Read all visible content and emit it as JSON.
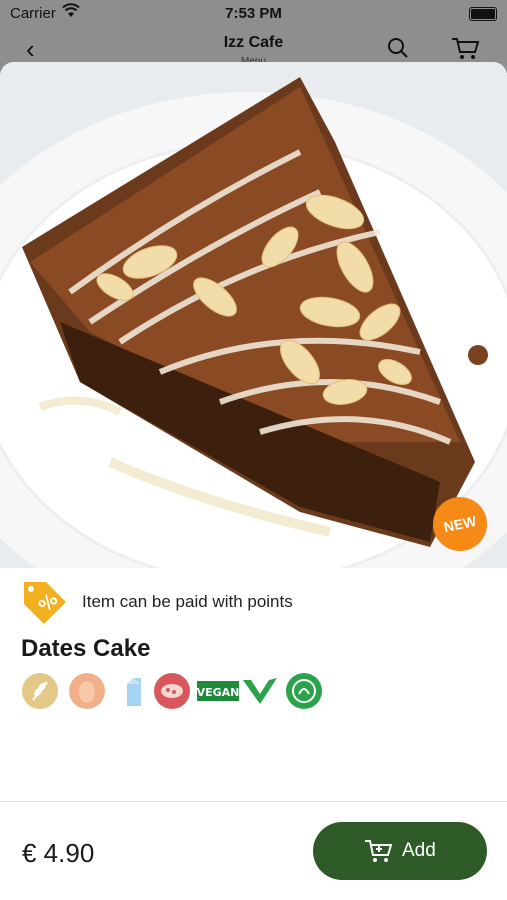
{
  "status_bar": {
    "carrier": "Carrier",
    "time": "7:53 PM"
  },
  "nav": {
    "title": "Izz Cafe",
    "subtitle": "Menu"
  },
  "product": {
    "badge": "NEW",
    "points_text": "Item can be paid with points",
    "name": "Dates Cake",
    "allergens": [
      "gluten-icon",
      "egg-icon",
      "milk-icon",
      "sesame-icon",
      "vegan-text-icon",
      "vegan-v-icon",
      "halal-icon"
    ],
    "vegan_label": "VEGAN",
    "price": "€ 4.90",
    "add_label": "Add"
  },
  "colors": {
    "accent": "#2d5a27",
    "badge": "#f58a17",
    "tag": "#f2b01e"
  }
}
